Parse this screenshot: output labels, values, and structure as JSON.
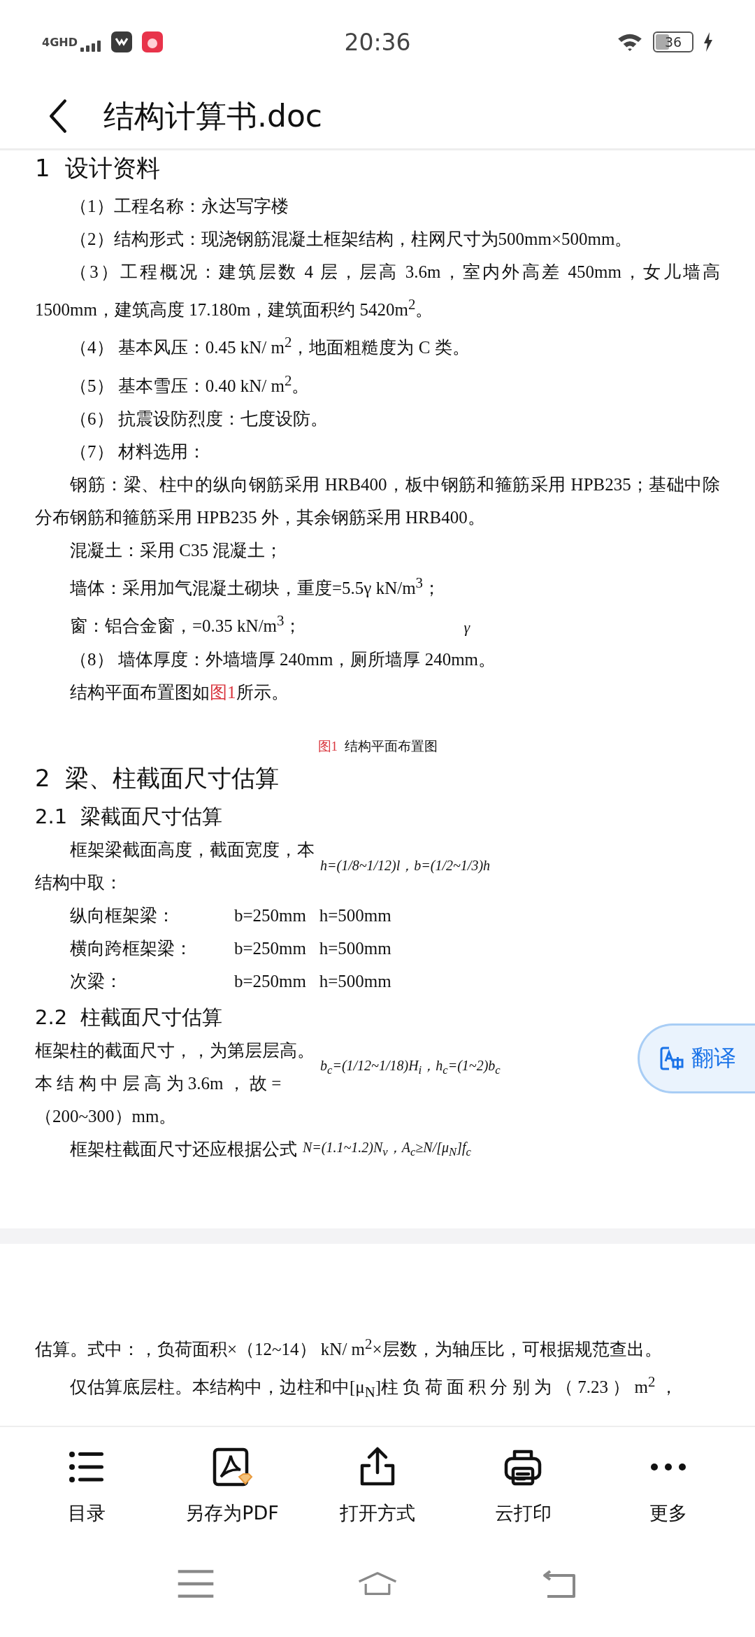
{
  "status_bar": {
    "network": "4GHD",
    "time": "20:36",
    "battery": "36",
    "charging": true
  },
  "header": {
    "title": "结构计算书.doc"
  },
  "document": [
    {
      "kind": "h1",
      "text": "1  设计资料"
    },
    {
      "kind": "p",
      "indent": true,
      "text": "（1）工程名称：永达写字楼"
    },
    {
      "kind": "p",
      "indent": true,
      "text": "（2）结构形式：现浇钢筋混凝土框架结构，柱网尺寸为500mm×500mm。"
    },
    {
      "kind": "p",
      "indent": true,
      "text": "（3）工程概况：建筑层数 4 层，层高 3.6m，室内外高差 450mm，女儿墙高 1500mm，建筑高度 17.180m，建筑面积约 5420m$^{2}$。"
    },
    {
      "kind": "p",
      "indent": true,
      "text": "（4） 基本风压：0.45 kN/ m$^{2}$，地面粗糙度为 C 类。"
    },
    {
      "kind": "p",
      "indent": true,
      "text": "（5） 基本雪压：0.40 kN/ m$^{2}$。"
    },
    {
      "kind": "p",
      "indent": true,
      "text": "（6） 抗震设防烈度：七度设防。"
    },
    {
      "kind": "p",
      "indent": true,
      "text": "（7） 材料选用："
    },
    {
      "kind": "p",
      "indent": true,
      "text": "钢筋：梁、柱中的纵向钢筋采用 HRB400，板中钢筋和箍筋采用 HPB235；基础中除分布钢筋和箍筋采用 HPB235 外，其余钢筋采用 HRB400。"
    },
    {
      "kind": "p",
      "indent": true,
      "text": "混凝土：采用 C35 混凝土；"
    },
    {
      "kind": "p",
      "indent": true,
      "text": "墙体：采用加气混凝土砌块，重度=5.5γ kN/m$^{3}$；"
    },
    {
      "kind": "p",
      "indent": true,
      "text": "窗：铝合金窗，=0.35 kN/m$^{3}$；",
      "aside": "γ"
    },
    {
      "kind": "p",
      "indent": true,
      "text": "（8） 墙体厚度：外墙墙厚 240mm，厕所墙厚 240mm。"
    },
    {
      "kind": "ref_p",
      "before": "结构平面布置图如",
      "ref": "图1",
      "after": "所示。"
    },
    {
      "kind": "caption",
      "ref": "图1",
      "text": "结构平面布置图"
    },
    {
      "kind": "h1",
      "text": "2  梁、柱截面尺寸估算"
    },
    {
      "kind": "h2",
      "text": "2.1  梁截面尺寸估算"
    },
    {
      "kind": "formula_p",
      "indent": true,
      "lines": [
        "框架梁截面高度，截面宽度，本",
        "结构中取："
      ],
      "formula": "h=(1/8~1/12)l，b=(1/2~1/3)h"
    },
    {
      "kind": "dim",
      "label": "纵向框架梁：",
      "value": "b=250mm   h=500mm"
    },
    {
      "kind": "dim",
      "label": "横向跨框架梁：",
      "value": "b=250mm   h=500mm"
    },
    {
      "kind": "dim",
      "label": "次梁：",
      "value": "b=250mm   h=500mm"
    },
    {
      "kind": "h2",
      "text": "2.2  柱截面尺寸估算"
    },
    {
      "kind": "formula_p",
      "indent": false,
      "lines": [
        "框架柱的截面尺寸，，为第层层高。",
        "本 结 构 中 层 高 为 3.6m ， 故 ="
      ],
      "formula": "b$_{c}$=(1/12~1/18)H$_{i}$，h$_{c}$=(1~2)b$_{c}$"
    },
    {
      "kind": "p",
      "indent": false,
      "text": "（200~300）mm。"
    },
    {
      "kind": "formula_p",
      "indent": true,
      "lines": [
        "框架柱截面尺寸还应根据公式"
      ],
      "formula": "N=(1.1~1.2)N$_{v}$，A$_{c}$≥N/[μ$_{N}$]f$_{c}$"
    },
    {
      "kind": "page_break"
    },
    {
      "kind": "p",
      "indent": false,
      "text": "估算。式中：，负荷面积×（12~14） kN/ m$^{2}$×层数，为轴压比，可根据规范查出。"
    },
    {
      "kind": "p",
      "indent": true,
      "text": "仅估算底层柱。本结构中，边柱和中[μ$_{N}$]柱 负 荷 面 积 分 别 为 （ 7.23 ） m$^{2}$ ，"
    }
  ],
  "translate_button": {
    "label": "翻译"
  },
  "toolbar": [
    {
      "kind": "list",
      "label": "目录"
    },
    {
      "kind": "pdf",
      "label": "另存为PDF"
    },
    {
      "kind": "share",
      "label": "打开方式"
    },
    {
      "kind": "print",
      "label": "云打印"
    },
    {
      "kind": "more",
      "label": "更多"
    }
  ]
}
